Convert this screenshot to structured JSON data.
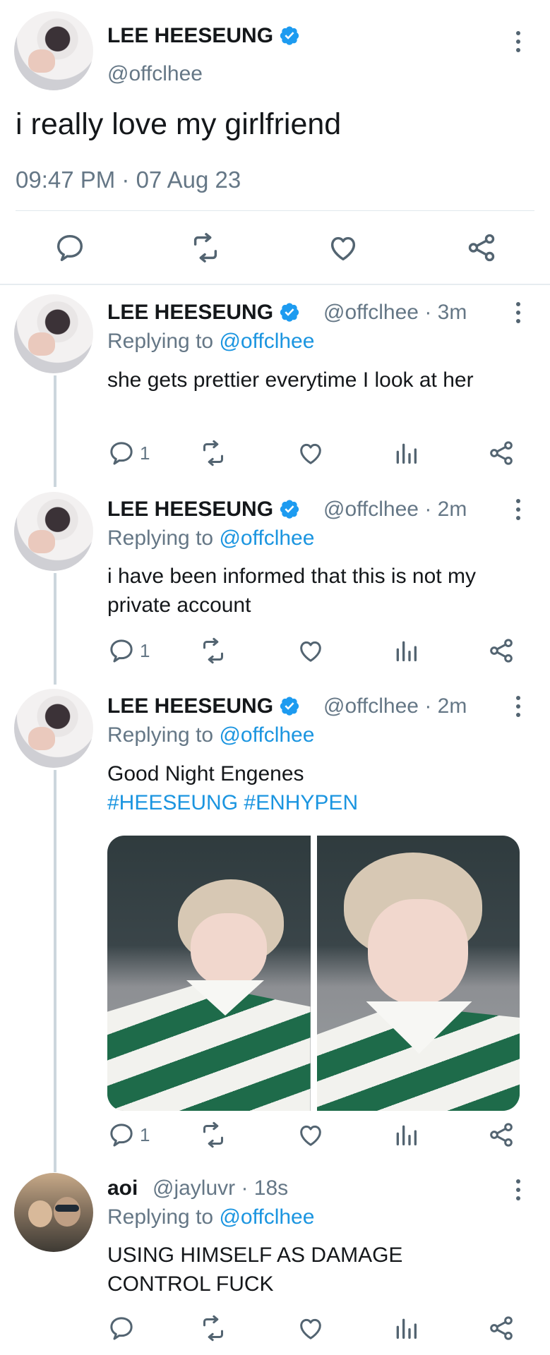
{
  "main_tweet": {
    "name": "LEE HEESEUNG",
    "handle": "@offclhee",
    "text": "i really love my girlfriend",
    "timestamp": "09:47 PM · 07 Aug 23"
  },
  "replies": [
    {
      "name": "LEE HEESEUNG",
      "handle": "@offclhee · 3m",
      "replying_prefix": "Replying to",
      "replying_mention": "@offclhee",
      "text": "she gets prettier everytime I look at her",
      "reply_count": "1"
    },
    {
      "name": "LEE HEESEUNG",
      "handle": "@offclhee · 2m",
      "replying_prefix": "Replying to",
      "replying_mention": "@offclhee",
      "text": "i have been informed that this is not my private account",
      "reply_count": "1"
    },
    {
      "name": "LEE HEESEUNG",
      "handle": "@offclhee · 2m",
      "replying_prefix": "Replying to",
      "replying_mention": "@offclhee",
      "text": "Good Night Engenes",
      "hashtags": "#HEESEUNG #ENHYPEN",
      "reply_count": "1"
    },
    {
      "name": "aoi",
      "handle": "@jayluvr · 18s",
      "replying_prefix": "Replying to",
      "replying_mention": "@offclhee",
      "text": "USING HIMSELF AS DAMAGE CONTROL FUCK",
      "reply_count": ""
    }
  ],
  "colors": {
    "link": "#1b95e0",
    "secondary_text": "#657786",
    "verified": "#1d9bf0"
  },
  "icons": [
    "reply-icon",
    "retweet-icon",
    "like-icon",
    "analytics-icon",
    "share-icon",
    "more-icon",
    "verified-badge-icon"
  ]
}
